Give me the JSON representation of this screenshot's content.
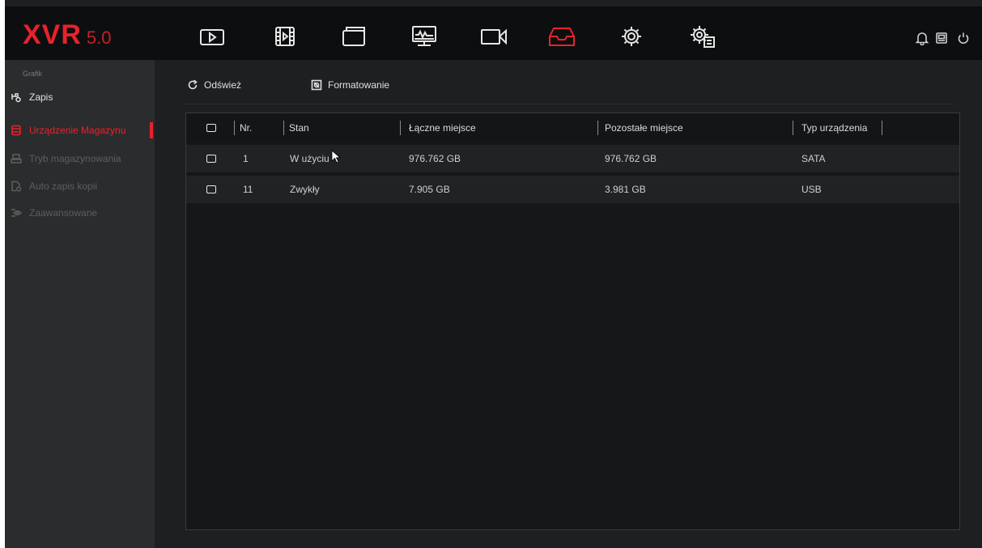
{
  "app": {
    "logo_main": "XVR",
    "logo_version": "5.0"
  },
  "topnav": {
    "items": [
      {
        "name": "playback",
        "icon": "play-icon"
      },
      {
        "name": "video-clip",
        "icon": "film-icon"
      },
      {
        "name": "files",
        "icon": "folder-icon"
      },
      {
        "name": "network-monitor",
        "icon": "monitor-icon"
      },
      {
        "name": "camera",
        "icon": "camera-icon"
      },
      {
        "name": "storage",
        "icon": "storage-tray-icon",
        "active": true
      },
      {
        "name": "settings",
        "icon": "gear-icon"
      },
      {
        "name": "system-settings",
        "icon": "gear-document-icon"
      }
    ],
    "right": [
      "bell-icon",
      "display-icon",
      "power-icon"
    ],
    "accent_color": "#e8222a"
  },
  "sidebar": {
    "group_label": "Grafik",
    "top_item": {
      "label": "Zapis",
      "icon": "record-schedule-icon"
    },
    "items": [
      {
        "label": "Urządzenie Magazynu",
        "icon": "database-icon",
        "active": true
      },
      {
        "label": "Tryb magazynowania",
        "icon": "storage-mode-icon"
      },
      {
        "label": "Auto zapis kopii",
        "icon": "backup-icon"
      },
      {
        "label": "Zaawansowane",
        "icon": "advanced-eye-icon"
      }
    ]
  },
  "toolbar": {
    "refresh_label": "Odśwież",
    "format_label": "Formatowanie"
  },
  "table": {
    "columns": [
      "Nr.",
      "Stan",
      "Łączne miejsce",
      "Pozostałe miejsce",
      "Typ urządzenia"
    ],
    "rows": [
      {
        "nr": "1",
        "stan": "W użyciu",
        "total": "976.762 GB",
        "free": "976.762 GB",
        "type": "SATA"
      },
      {
        "nr": "11",
        "stan": "Zwykły",
        "total": "7.905 GB",
        "free": "3.981 GB",
        "type": "USB"
      }
    ]
  }
}
